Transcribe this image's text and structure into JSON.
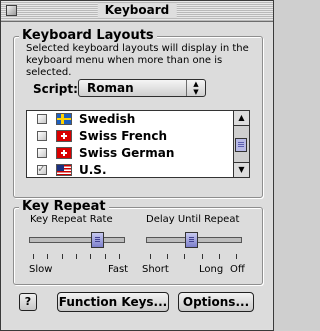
{
  "window": {
    "title": "Keyboard"
  },
  "layouts": {
    "title": "Keyboard Layouts",
    "description": "Selected keyboard layouts will display in the keyboard menu when more than one is selected.",
    "script_label": "Script:",
    "script_value": "Roman",
    "items": [
      {
        "label": "Swedish",
        "checked": false,
        "flag": "sweden-flag-icon"
      },
      {
        "label": "Swiss French",
        "checked": false,
        "flag": "switzerland-flag-icon"
      },
      {
        "label": "Swiss German",
        "checked": false,
        "flag": "switzerland-flag-icon"
      },
      {
        "label": "U.S.",
        "checked": true,
        "flag": "usa-flag-icon"
      }
    ]
  },
  "key_repeat": {
    "title": "Key Repeat",
    "rate_label": "Key Repeat Rate",
    "delay_label": "Delay Until Repeat",
    "rate_min": "Slow",
    "rate_max": "Fast",
    "delay_min": "Short",
    "delay_mid": "Long",
    "delay_max": "Off",
    "rate_level": 0.72,
    "delay_level": 0.48
  },
  "buttons": {
    "help": "?",
    "function_keys": "Function Keys...",
    "options": "Options..."
  },
  "colors": {
    "accent": "#7d80cc",
    "window_bg": "#dedede"
  }
}
